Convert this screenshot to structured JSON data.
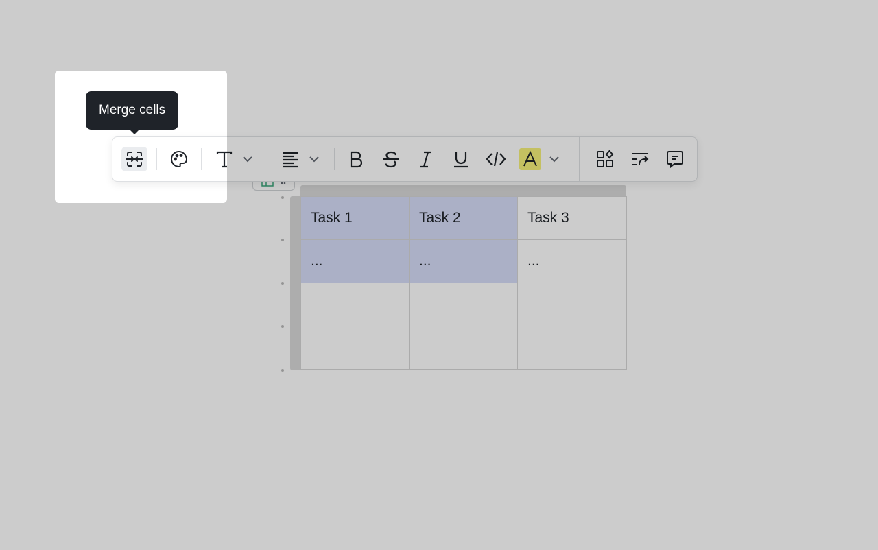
{
  "tooltip": {
    "text": "Merge cells"
  },
  "toolbar": {
    "buttons": [
      {
        "name": "merge-cells-button",
        "icon": "merge-cells-icon",
        "active": true
      },
      {
        "name": "cell-color-button",
        "icon": "palette-icon"
      },
      {
        "name": "text-style-button",
        "icon": "text-t-icon",
        "dropdown": true
      },
      {
        "name": "align-button",
        "icon": "align-left-icon",
        "dropdown": true
      },
      {
        "name": "bold-button",
        "icon": "bold-icon"
      },
      {
        "name": "strikethrough-button",
        "icon": "strikethrough-icon"
      },
      {
        "name": "italic-button",
        "icon": "italic-icon"
      },
      {
        "name": "underline-button",
        "icon": "underline-icon"
      },
      {
        "name": "code-button",
        "icon": "code-icon"
      },
      {
        "name": "highlight-button",
        "icon": "highlight-a-icon",
        "dropdown": true
      },
      {
        "name": "blocks-button",
        "icon": "blocks-icon"
      },
      {
        "name": "wrap-text-button",
        "icon": "wrap-text-icon"
      },
      {
        "name": "comment-button",
        "icon": "comment-icon"
      }
    ],
    "highlight_color": "#f5f07a"
  },
  "table": {
    "rows": [
      [
        "Task 1",
        "Task 2",
        "Task 3"
      ],
      [
        "...",
        "...",
        "..."
      ],
      [
        "",
        "",
        ""
      ],
      [
        "",
        "",
        ""
      ]
    ],
    "selection_color": "#d6dcf8"
  }
}
